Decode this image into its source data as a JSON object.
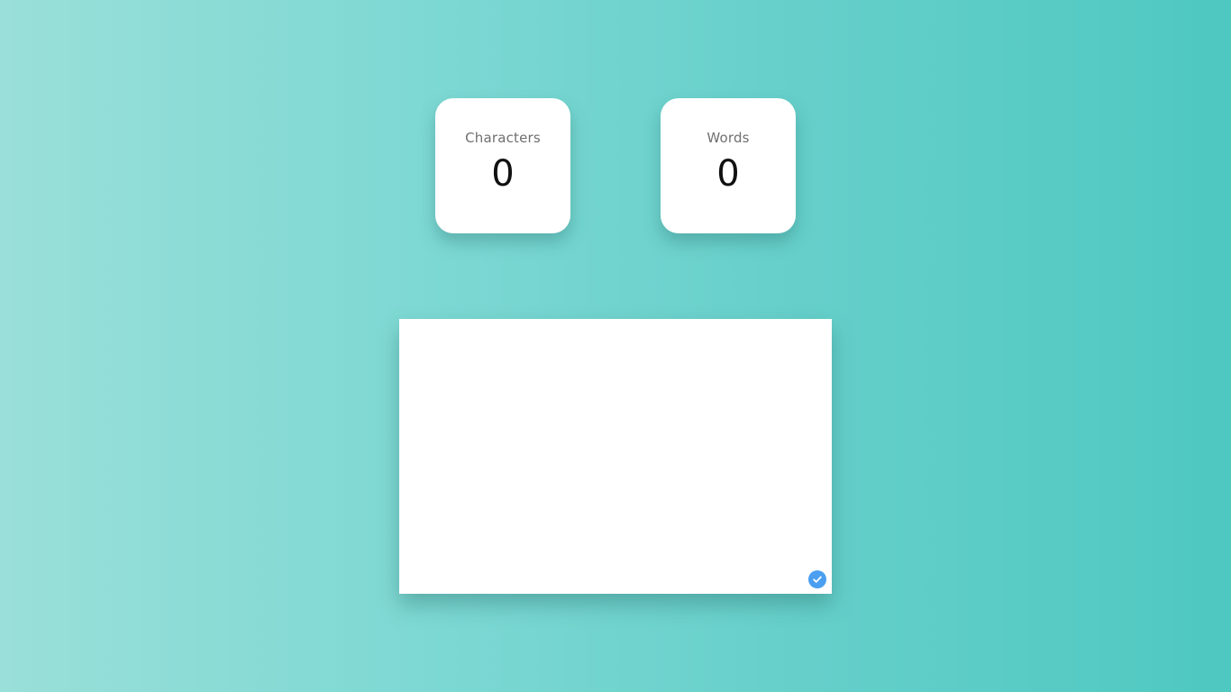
{
  "stats": {
    "characters": {
      "label": "Characters",
      "value": "0"
    },
    "words": {
      "label": "Words",
      "value": "0"
    }
  },
  "editor": {
    "value": "",
    "placeholder": ""
  },
  "icons": {
    "grammar_check": "check-circle-icon"
  },
  "colors": {
    "background_start": "#9adfd9",
    "background_end": "#4ec8c1",
    "card": "#ffffff",
    "check_badge": "#4a9ff0"
  }
}
